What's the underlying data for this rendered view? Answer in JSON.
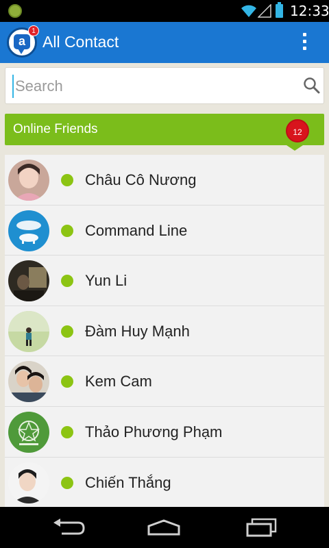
{
  "status_bar": {
    "time": "12:33"
  },
  "action_bar": {
    "title": "All Contact",
    "logo_letter": "a",
    "logo_badge": "1"
  },
  "search": {
    "placeholder": "Search"
  },
  "online_section": {
    "title": "Online Friends",
    "count": "12"
  },
  "contacts": [
    {
      "name": "Châu Cô Nương",
      "avatar": "person-pink-photo"
    },
    {
      "name": "Command Line",
      "avatar": "polar-bear-cloud-photo"
    },
    {
      "name": "Yun Li",
      "avatar": "dark-room-photo"
    },
    {
      "name": "Đàm Huy Mạnh",
      "avatar": "outdoor-person-photo"
    },
    {
      "name": "Kem Cam",
      "avatar": "couple-selfie-photo"
    },
    {
      "name": "Thảo Phương Phạm",
      "avatar": "green-emblem-logo"
    },
    {
      "name": "Chiến Thắng",
      "avatar": "man-portrait-photo"
    }
  ],
  "colors": {
    "action_bar": "#1a77d2",
    "online_header": "#7bbd1b",
    "online_dot": "#8cc413",
    "badge": "#d8141d"
  }
}
